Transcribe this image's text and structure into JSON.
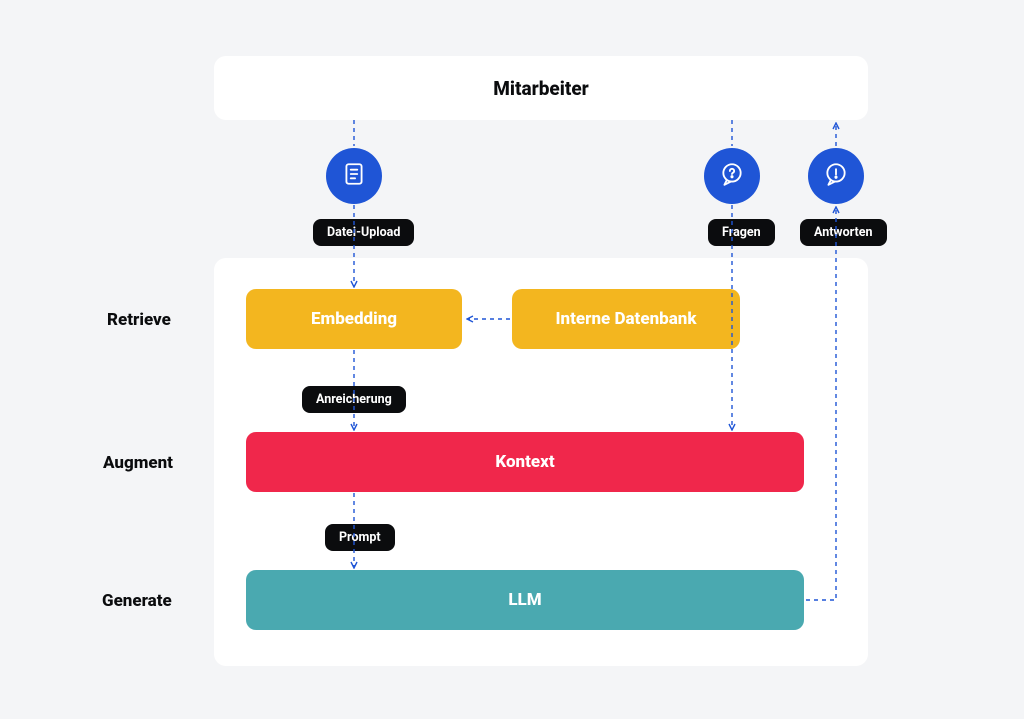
{
  "colors": {
    "primary_blue": "#1f55d6",
    "amber": "#f3b61f",
    "red": "#f0274b",
    "teal": "#4aa9b0",
    "ink": "#0b0c0e",
    "bg": "#f4f5f7"
  },
  "header": {
    "title": "Mitarbeiter"
  },
  "icons": {
    "upload": "document-icon",
    "question": "question-bubble-icon",
    "answer": "exclamation-bubble-icon"
  },
  "pills": {
    "upload": "Datei-Upload",
    "fragen": "Fragen",
    "antworten": "Antworten",
    "anreicherung": "Anreicherung",
    "prompt": "Prompt"
  },
  "phases": {
    "retrieve": "Retrieve",
    "augment": "Augment",
    "generate": "Generate"
  },
  "boxes": {
    "embedding": "Embedding",
    "internal_db": "Interne Datenbank",
    "kontext": "Kontext",
    "llm": "LLM"
  }
}
